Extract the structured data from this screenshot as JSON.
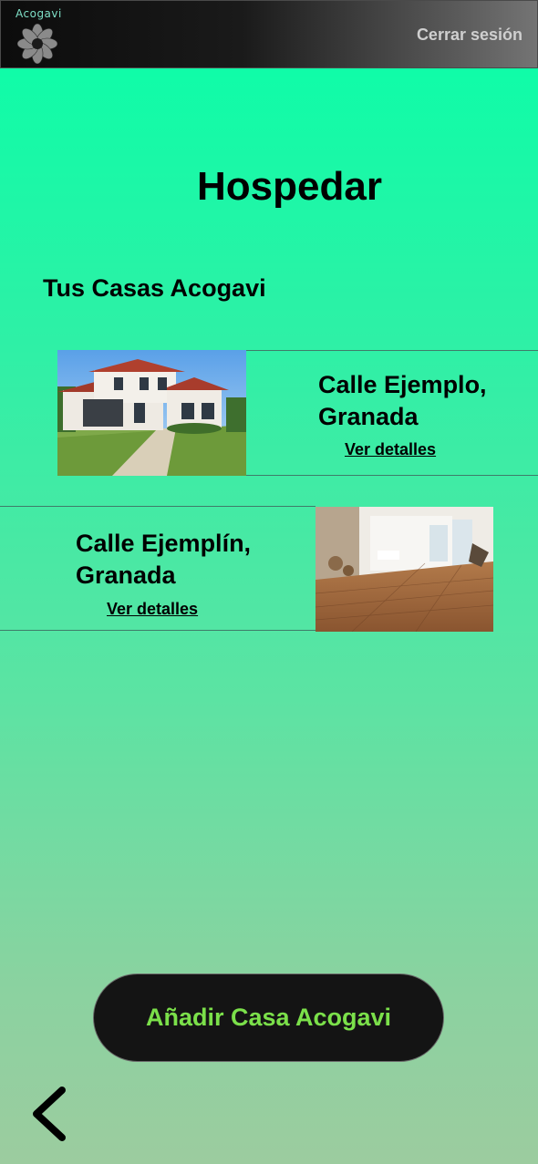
{
  "header": {
    "brand": "Acogavi",
    "logout_label": "Cerrar sesión"
  },
  "page": {
    "title": "Hospedar",
    "section_title": "Tus Casas Acogavi"
  },
  "houses": [
    {
      "address_line1": "Calle Ejemplo,",
      "address_line2": "Granada",
      "details_label": "Ver detalles",
      "image": "house-exterior-photo"
    },
    {
      "address_line1": "Calle Ejemplín,",
      "address_line2": "Granada",
      "details_label": "Ver detalles",
      "image": "interior-wood-floor-photo"
    }
  ],
  "actions": {
    "add_label": "Añadir Casa Acogavi",
    "back_icon": "chevron-left-icon"
  },
  "colors": {
    "accent": "#7be04a",
    "bg_top": "#08ffa8",
    "bg_bottom": "#9ccc9f"
  }
}
